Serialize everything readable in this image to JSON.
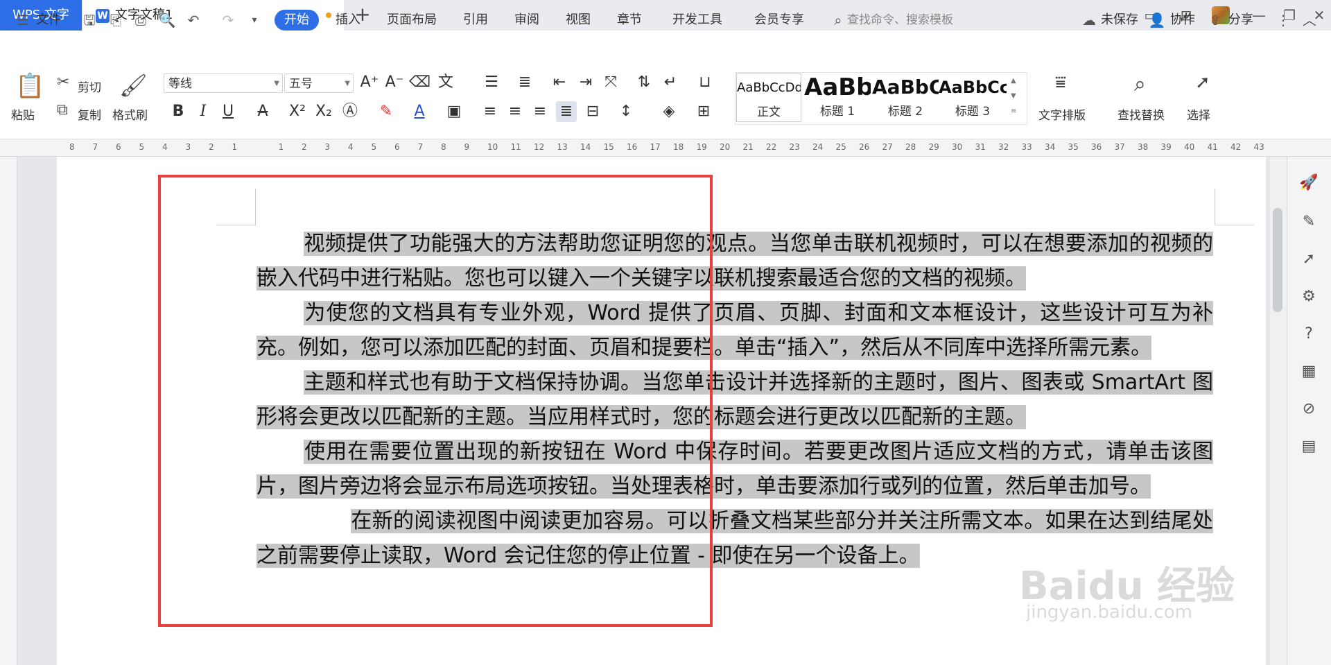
{
  "titlebar": {
    "app_tab": "WPS 文字",
    "doc_tab": "文字文稿1",
    "new_tab": "+"
  },
  "menubar": {
    "file": "文件",
    "tabs": [
      "开始",
      "插入",
      "页面布局",
      "引用",
      "审阅",
      "视图",
      "章节",
      "开发工具",
      "会员专享"
    ],
    "search_placeholder": "查找命令、搜索模板",
    "unsaved": "未保存",
    "collab": "协作",
    "share": "分享"
  },
  "ribbon": {
    "paste": "粘贴",
    "cut": "剪切",
    "copy": "复制",
    "format_painter": "格式刷",
    "font_name": "等线",
    "font_size": "五号",
    "styles": [
      {
        "preview": "AaBbCcDd",
        "label": "正文"
      },
      {
        "preview": "AaBb",
        "label": "标题 1"
      },
      {
        "preview": "AaBbC",
        "label": "标题 2"
      },
      {
        "preview": "AaBbCc",
        "label": "标题 3"
      }
    ],
    "text_layout": "文字排版",
    "find_replace": "查找替换",
    "select": "选择"
  },
  "ruler": {
    "ticks": [
      "8",
      "7",
      "6",
      "5",
      "4",
      "3",
      "2",
      "1",
      "",
      "1",
      "2",
      "3",
      "4",
      "5",
      "6",
      "7",
      "8",
      "9",
      "10",
      "11",
      "12",
      "13",
      "14",
      "15",
      "16",
      "17",
      "18",
      "19",
      "20",
      "21",
      "22",
      "23",
      "24",
      "25",
      "26",
      "27",
      "28",
      "29",
      "30",
      "31",
      "32",
      "33",
      "34",
      "35",
      "36",
      "37",
      "38",
      "39",
      "40",
      "41",
      "42",
      "43"
    ]
  },
  "document": {
    "paragraphs": [
      "视频提供了功能强大的方法帮助您证明您的观点。当您单击联机视频时，可以在想要添加的视频的嵌入代码中进行粘贴。您也可以键入一个关键字以联机搜索最适合您的文档的视频。",
      "为使您的文档具有专业外观，Word 提供了页眉、页脚、封面和文本框设计，这些设计可互为补充。例如，您可以添加匹配的封面、页眉和提要栏。单击“插入”，然后从不同库中选择所需元素。",
      "主题和样式也有助于文档保持协调。当您单击设计并选择新的主题时，图片、图表或 SmartArt 图形将会更改以匹配新的主题。当应用样式时，您的标题会进行更改以匹配新的主题。",
      "使用在需要位置出现的新按钮在 Word 中保存时间。若要更改图片适应文档的方式，请单击该图片，图片旁边将会显示布局选项按钮。当处理表格时，单击要添加行或列的位置，然后单击加号。",
      "在新的阅读视图中阅读更加容易。可以折叠文档某些部分并关注所需文本。如果在达到结尾处之前需要停止读取，Word 会记住您的停止位置 - 即使在另一个设备上。"
    ]
  },
  "watermark": {
    "main": "Baidu 经验",
    "sub": "jingyan.baidu.com"
  },
  "colors": {
    "accent": "#2e6fe8",
    "highlight": "#c7c7c7",
    "marker": "#e8403a"
  }
}
